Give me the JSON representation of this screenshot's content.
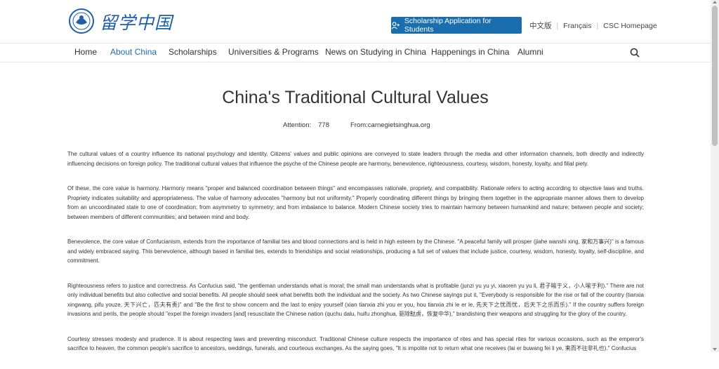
{
  "header": {
    "logo_text": "留学中国",
    "apply_button": "Scholarship Application for Students",
    "lang_cn": "中文版",
    "lang_fr": "Français",
    "csc_home": "CSC Homepage"
  },
  "nav": {
    "items": [
      {
        "label": "Home",
        "active": false
      },
      {
        "label": "About China",
        "active": true
      },
      {
        "label": "Scholarships",
        "active": false
      },
      {
        "label": "Universities & Programs",
        "active": false
      },
      {
        "label": "News on Studying in China",
        "active": false
      },
      {
        "label": "Happenings in China",
        "active": false
      },
      {
        "label": "Alumni",
        "active": false
      }
    ]
  },
  "article": {
    "title": "China's Traditional Cultural Values",
    "attention_label": "Attention:",
    "attention_value": "778",
    "from": "From:carnegietsinghua.org",
    "paragraphs": [
      "The cultural values of a country influence its national psychology and identity. Citizens' values and public opinions are conveyed to state leaders through the media and other information channels, both directly and indirectly influencing decisions on foreign policy. The traditional cultural values that influence the psyche of the Chinese people are harmony, benevolence, righteousness, courtesy, wisdom, honesty, loyalty, and filial piety.",
      "Of these, the core value is harmony. Harmony means \"proper and balanced coordination between things\" and encompasses rationale, propriety, and compatibility. Rationale refers to acting according to objective laws and truths. Propriety indicates suitability and appropriateness. The value of harmony advocates \"harmony but not uniformity.\" Properly coordinating different things by bringing them together in the appropriate manner allows them to develop from an uncoordinated state to one of coordination; from asymmetry to symmetry; and from imbalance to balance. Modern Chinese society tries to maintain harmony between humankind and nature; between people and society; between members of different communities; and between mind and body.",
      "Benevolence, the core value of Confucianism, extends from the importance of familial ties and blood connections and is held in high esteem by the Chinese. \"A peaceful family will prosper (jiahe wanshi xing, 家和万事兴)\" is a famous and widely embraced saying. This benevolence, although based in familial ties, extends to friendships and social relationships, producing a full set of values that include justice, courtesy, wisdom, honesty, loyalty, self-discipline, and commitment.",
      "Righteousness refers to justice and correctness. As Confucius said, \"the gentleman understands what is moral; the small man understands what is profitable (junzi yu yu yi, xiaoren yu yu li, 君子喻于义，小人喻于利).\" There are not only individual benefits but also collective and social benefits. All people should seek what benefits both the individual and the society. As two Chinese sayings put it, \"Everybody is responsible for the rise or fall of the country (tianxia xingwang, pifu youze, 天下兴亡，匹夫有责)\" and \"Be the first to show concern and the last to enjoy yourself (xian tianxia zhi you er you, hou tianxia zhi le er le, 先天下之忧而忧，后天下之乐而乐).\" If the country suffers foreign invasions and perils, the people should \"expel the foreign invaders [and] resuscitate the Chinese nation (quchu dalu, huifu zhonghua, 驱除鞑虏，恢复中华),\" brandishing their weapons and struggling for the glory of the country.",
      "Courtesy stresses modesty and prudence. It is about respecting laws and preventing misconduct. Traditional Chinese culture respects the importance of rites and has special rites for various occasions, such as the emperor's sacrifice to heaven, the common people's sacrifice to ancestors, weddings, funerals, and courteous exchanges. As the saying goes, \"It is impolite not to return what one receives (lai er buwang fei li ye, 来而不往非礼也).\" Confucius"
    ]
  },
  "colors": {
    "brand_blue": "#1a6eae",
    "nav_text": "#333333"
  }
}
